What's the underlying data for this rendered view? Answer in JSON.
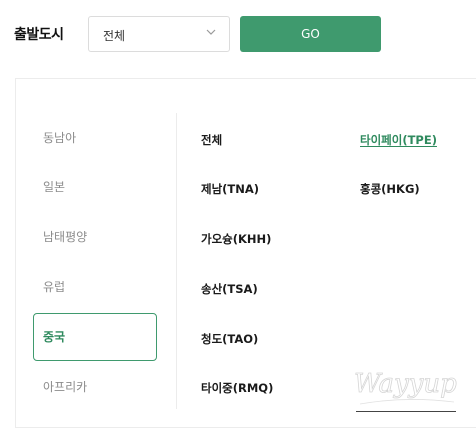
{
  "search": {
    "departure_label": "출발도시",
    "city_select_value": "전체",
    "go_label": "GO"
  },
  "regions": [
    {
      "label": "동남아",
      "active": false
    },
    {
      "label": "일본",
      "active": false
    },
    {
      "label": "남태평양",
      "active": false
    },
    {
      "label": "유럽",
      "active": false
    },
    {
      "label": "중국",
      "active": true
    },
    {
      "label": "아프리카",
      "active": false
    }
  ],
  "cities": {
    "column1": [
      "전체",
      "제남(TNA)",
      "가오슝(KHH)",
      "송산(TSA)",
      "청도(TAO)",
      "타이중(RMQ)"
    ],
    "column2": [
      "타이페이(TPE)",
      "홍콩(HKG)"
    ],
    "selected": "타이페이(TPE)"
  },
  "watermark": {
    "text": "Wayyup"
  },
  "colors": {
    "accent": "#3f9a6e",
    "accent_text": "#2f8a5e",
    "muted_text": "#8c8c8c",
    "border": "#dcdcdc"
  },
  "icons": {
    "select_arrow": "chevron-down-icon"
  }
}
